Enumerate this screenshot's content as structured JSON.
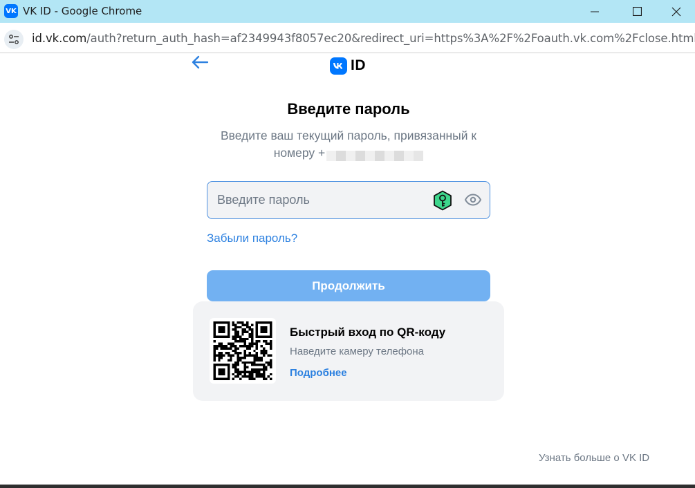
{
  "window": {
    "app_icon_label": "VK",
    "title": "VK ID - Google Chrome"
  },
  "address_bar": {
    "url_host": "id.vk.com",
    "url_path": "/auth?return_auth_hash=af2349943f8057ec20&redirect_uri=https%3A%2F%2Foauth.vk.com%2Fclose.html&re..."
  },
  "page": {
    "logo_text": "ID",
    "title": "Введите пароль",
    "subtitle_line1": "Введите ваш текущий пароль, привязанный к",
    "subtitle_line2": "номеру +",
    "password": {
      "placeholder": "Введите пароль",
      "value": ""
    },
    "forgot_link": "Забыли пароль?",
    "continue_button": "Продолжить",
    "qr": {
      "title": "Быстрый вход по QR-коду",
      "subtitle": "Наведите камеру телефона",
      "more_link": "Подробнее"
    },
    "learn_more": "Узнать больше о VK ID"
  },
  "colors": {
    "accent": "#2d81e0",
    "vk_blue": "#0077ff",
    "button_disabled": "#72b1f2",
    "titlebar": "#b3e6f5"
  },
  "icons": [
    "vk-app-icon",
    "minimize-icon",
    "maximize-icon",
    "close-icon",
    "site-info-icon",
    "back-arrow-icon",
    "vk-logo-icon",
    "password-key-icon",
    "show-password-eye-icon",
    "qr-code-icon"
  ]
}
